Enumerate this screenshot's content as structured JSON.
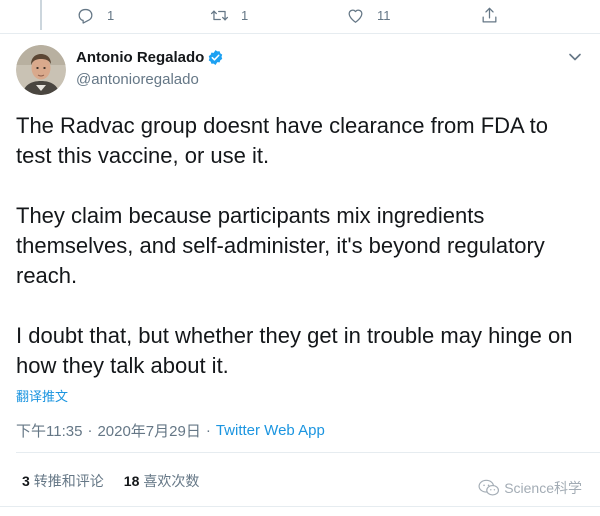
{
  "actions": {
    "reply_count": "1",
    "retweet_count": "1",
    "like_count": "11"
  },
  "author": {
    "name": "Antonio Regalado",
    "handle": "@antonioregalado"
  },
  "tweet": {
    "paragraphs": [
      "The Radvac group doesnt have clearance from FDA to test this vaccine, or use it.",
      "They claim because participants mix ingredients themselves, and self-administer, it's beyond regulatory reach.",
      "I doubt that, but whether they get in trouble may hinge on how they talk about it."
    ],
    "translate_label": "翻译推文"
  },
  "meta": {
    "time": "下午11:35",
    "separator": "·",
    "date": "2020年7月29日",
    "source": "Twitter Web App"
  },
  "stats": {
    "retweets_count": "3",
    "retweets_label": "转推和评论",
    "likes_count": "18",
    "likes_label": "喜欢次数"
  },
  "watermark": {
    "text": "Science科学"
  },
  "colors": {
    "accent": "#1b95e0",
    "muted": "#657786",
    "divider": "#e6ecf0",
    "verified": "#1da1f2"
  }
}
